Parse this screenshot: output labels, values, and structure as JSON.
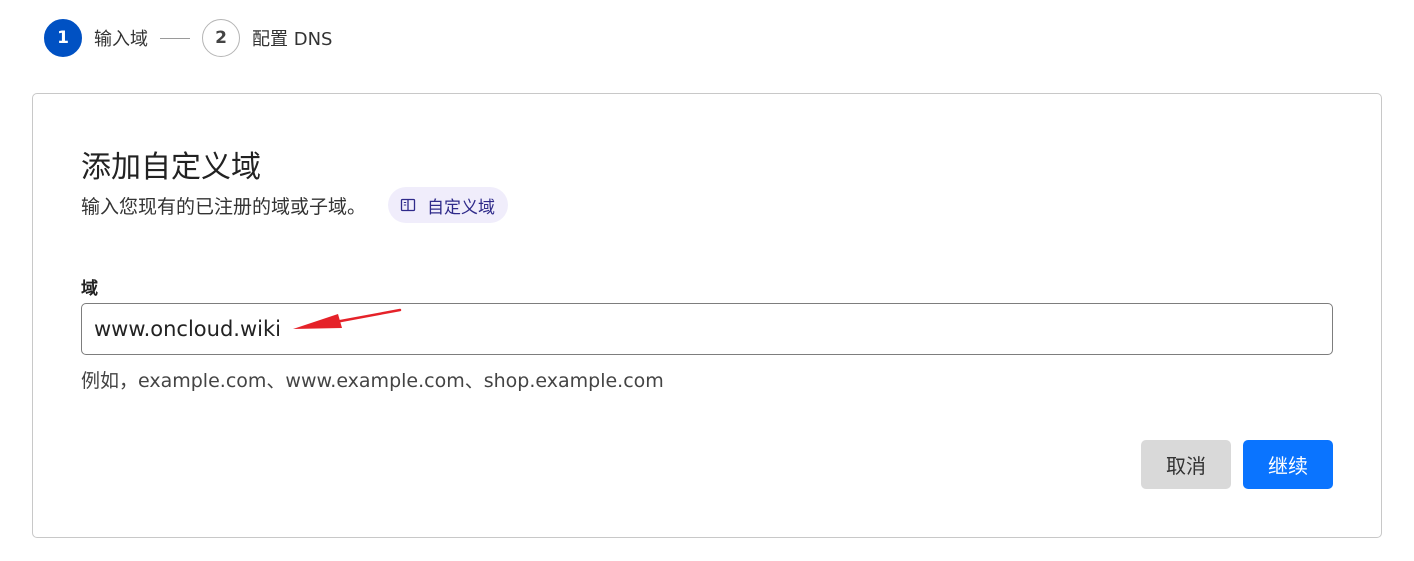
{
  "stepper": {
    "steps": [
      {
        "number": "1",
        "label": "输入域",
        "state": "active"
      },
      {
        "number": "2",
        "label": "配置 DNS",
        "state": "inactive"
      }
    ]
  },
  "card": {
    "title": "添加自定义域",
    "subtitle": "输入您现有的已注册的域或子域。",
    "doc_link": {
      "label": "自定义域",
      "icon": "book-icon"
    },
    "field": {
      "label": "域",
      "value": "www.oncloud.wiki",
      "hint": "例如，example.com、www.example.com、shop.example.com"
    },
    "actions": {
      "cancel_label": "取消",
      "continue_label": "继续"
    }
  },
  "colors": {
    "accent": "#0051c3",
    "primary_button": "#0a74ff",
    "secondary_button": "#d9d9d9",
    "pill_background": "#f0edfb",
    "annotation_arrow": "#e52229"
  }
}
